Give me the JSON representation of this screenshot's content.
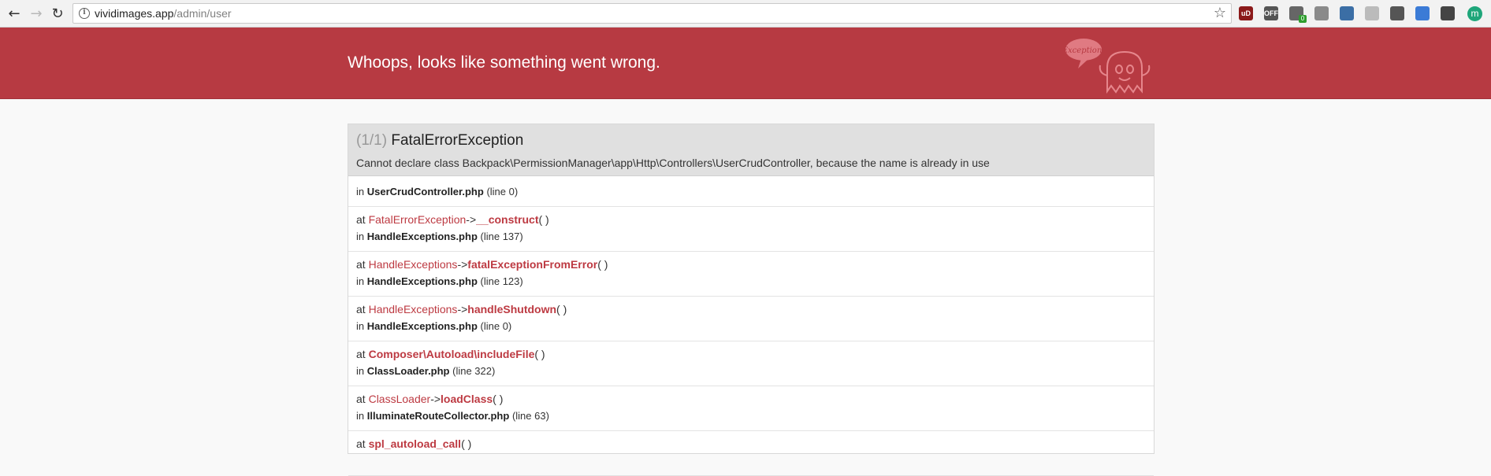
{
  "browser": {
    "url_host": "vividimages.app",
    "url_path": "/admin/user",
    "back_icon": "arrow-left-icon",
    "forward_icon": "arrow-right-icon",
    "reload_icon": "reload-icon",
    "bookmark_icon": "star-icon",
    "extension_badge": "0",
    "extensions": [
      {
        "label": "uD",
        "color": "#8b1a1a"
      },
      {
        "label": "OFF",
        "color": "#555555"
      },
      {
        "label": "",
        "color": "#666666"
      },
      {
        "label": "",
        "color": "#8a8a8a"
      },
      {
        "label": "",
        "color": "#3b6ea5"
      },
      {
        "label": "",
        "color": "#bbbbbb"
      },
      {
        "label": "",
        "color": "#555555"
      },
      {
        "label": "",
        "color": "#3b7bd6"
      },
      {
        "label": "",
        "color": "#444444"
      },
      {
        "label": "",
        "color": "#555555"
      }
    ],
    "avatar_letter": "m"
  },
  "banner": {
    "title": "Whoops, looks like something went wrong.",
    "bubble_text": "Exception!"
  },
  "exception": {
    "count": "(1/1)",
    "name": "FatalErrorException",
    "message": "Cannot declare class Backpack\\PermissionManager\\app\\Http\\Controllers\\UserCrudController, because the name is already in use",
    "origin": {
      "file": "UserCrudController.php",
      "line": "(line 0)"
    },
    "frames": [
      {
        "cls": "FatalErrorException",
        "sep": "->",
        "fn": "__construct",
        "file": "HandleExceptions.php",
        "line": "(line 137)"
      },
      {
        "cls": "HandleExceptions",
        "sep": "->",
        "fn": "fatalExceptionFromError",
        "file": "HandleExceptions.php",
        "line": "(line 123)"
      },
      {
        "cls": "HandleExceptions",
        "sep": "->",
        "fn": "handleShutdown",
        "file": "HandleExceptions.php",
        "line": "(line 0)"
      },
      {
        "cls": "",
        "sep": "",
        "fn": "Composer\\Autoload\\includeFile",
        "file": "ClassLoader.php",
        "line": "(line 322)"
      },
      {
        "cls": "ClassLoader",
        "sep": "->",
        "fn": "loadClass",
        "file": "IlluminateRouteCollector.php",
        "line": "(line 63)"
      },
      {
        "cls": "",
        "sep": "",
        "fn": "spl_autoload_call",
        "file": "",
        "line": ""
      }
    ],
    "words": {
      "at": "at",
      "in": "in",
      "parens": "( )"
    }
  }
}
